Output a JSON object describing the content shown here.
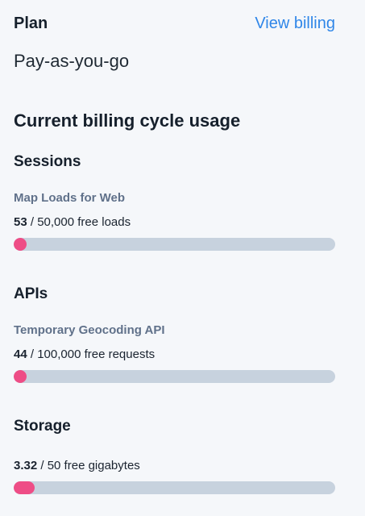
{
  "plan": {
    "heading": "Plan",
    "view_billing": "View billing",
    "value": "Pay-as-you-go"
  },
  "usage": {
    "heading": "Current billing cycle usage",
    "sections": [
      {
        "title": "Sessions",
        "label": "Map Loads for Web",
        "used": "53",
        "limit_text": " / 50,000 free loads",
        "fraction": 0.00106
      },
      {
        "title": "APIs",
        "label": "Temporary Geocoding API",
        "used": "44",
        "limit_text": " / 100,000 free requests",
        "fraction": 0.00044
      },
      {
        "title": "Storage",
        "label": "",
        "used": "3.32",
        "limit_text": " / 50 free gigabytes",
        "fraction": 0.0664
      }
    ]
  },
  "colors": {
    "accent_link": "#2f86e8",
    "progress_fill": "#ee4d86",
    "progress_track": "#c7d2de"
  }
}
